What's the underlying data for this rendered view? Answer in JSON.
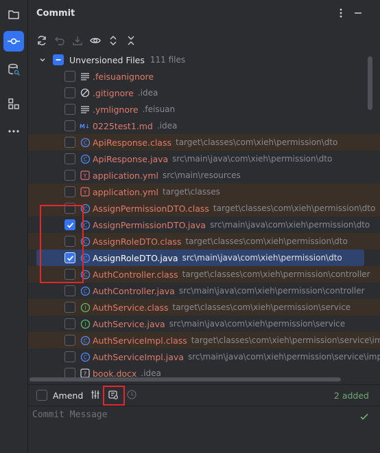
{
  "panel": {
    "title": "Commit"
  },
  "strip": {
    "items": [
      "folder-icon",
      "commit-icon",
      "database-icon",
      "structure-icon",
      "more-icon"
    ]
  },
  "toolbar": {
    "icons": [
      "refresh-icon",
      "rollback-icon",
      "download-icon",
      "eye-icon",
      "expand-icon",
      "collapse-icon"
    ]
  },
  "tree": {
    "group": {
      "label": "Unversioned Files",
      "count": "111 files",
      "checked": false
    },
    "rows": [
      {
        "name": ".feisuanignore",
        "path": "",
        "icon": "text-file-icon",
        "checked": false,
        "highlighted": false,
        "selected": false
      },
      {
        "name": ".gitignore",
        "path": ".idea",
        "icon": "ignore-file-icon",
        "checked": false,
        "highlighted": false,
        "selected": false
      },
      {
        "name": ".ymlignore",
        "path": ".feisuan",
        "icon": "text-file-icon",
        "checked": false,
        "highlighted": false,
        "selected": false
      },
      {
        "name": "0225test1.md",
        "path": ".idea",
        "icon": "markdown-icon",
        "checked": false,
        "highlighted": false,
        "selected": false
      },
      {
        "name": "ApiResponse.class",
        "path": "target\\classes\\com\\xieh\\permission\\dto",
        "icon": "class-icon",
        "checked": false,
        "highlighted": true,
        "selected": false
      },
      {
        "name": "ApiResponse.java",
        "path": "src\\main\\java\\com\\xieh\\permission\\dto",
        "icon": "class-icon",
        "checked": false,
        "highlighted": false,
        "selected": false
      },
      {
        "name": "application.yml",
        "path": "src\\main\\resources",
        "icon": "yaml-icon",
        "checked": false,
        "highlighted": false,
        "selected": false
      },
      {
        "name": "application.yml",
        "path": "target\\classes",
        "icon": "yaml-icon",
        "checked": false,
        "highlighted": true,
        "selected": false
      },
      {
        "name": "AssignPermissionDTO.class",
        "path": "target\\classes\\com\\xieh\\permission\\dto",
        "icon": "class-icon",
        "checked": false,
        "highlighted": true,
        "selected": false
      },
      {
        "name": "AssignPermissionDTO.java",
        "path": "src\\main\\java\\com\\xieh\\permission\\dto",
        "icon": "class-icon",
        "checked": true,
        "highlighted": false,
        "selected": false
      },
      {
        "name": "AssignRoleDTO.class",
        "path": "target\\classes\\com\\xieh\\permission\\dto",
        "icon": "class-icon",
        "checked": false,
        "highlighted": true,
        "selected": false
      },
      {
        "name": "AssignRoleDTO.java",
        "path": "src\\main\\java\\com\\xieh\\permission\\dto",
        "icon": "class-icon",
        "checked": true,
        "highlighted": false,
        "selected": true
      },
      {
        "name": "AuthController.class",
        "path": "target\\classes\\com\\xieh\\permission\\controller",
        "icon": "class-icon",
        "checked": false,
        "highlighted": true,
        "selected": false
      },
      {
        "name": "AuthController.java",
        "path": "src\\main\\java\\com\\xieh\\permission\\controller",
        "icon": "class-icon",
        "checked": false,
        "highlighted": false,
        "selected": false
      },
      {
        "name": "AuthService.class",
        "path": "target\\classes\\com\\xieh\\permission\\service",
        "icon": "interface-icon",
        "checked": false,
        "highlighted": true,
        "selected": false
      },
      {
        "name": "AuthService.java",
        "path": "src\\main\\java\\com\\xieh\\permission\\service",
        "icon": "interface-icon",
        "checked": false,
        "highlighted": false,
        "selected": false
      },
      {
        "name": "AuthServiceImpl.class",
        "path": "target\\classes\\com\\xieh\\permission\\service\\impl",
        "icon": "class-icon",
        "checked": false,
        "highlighted": true,
        "selected": false
      },
      {
        "name": "AuthServiceImpl.java",
        "path": "src\\main\\java\\com\\xieh\\permission\\service\\impl",
        "icon": "class-icon",
        "checked": false,
        "highlighted": false,
        "selected": false
      },
      {
        "name": "book.docx",
        "path": ".idea",
        "icon": "unknown-file-icon",
        "checked": false,
        "highlighted": false,
        "selected": false
      }
    ]
  },
  "bottom": {
    "amend_label": "Amend",
    "amend_checked": false,
    "status": "2 added",
    "commit_placeholder": "Commit Message"
  },
  "colors": {
    "accent": "#3574f0",
    "file_name": "#e07b6a",
    "status_added": "#6aab73",
    "annotation_box": "#e0282e"
  }
}
